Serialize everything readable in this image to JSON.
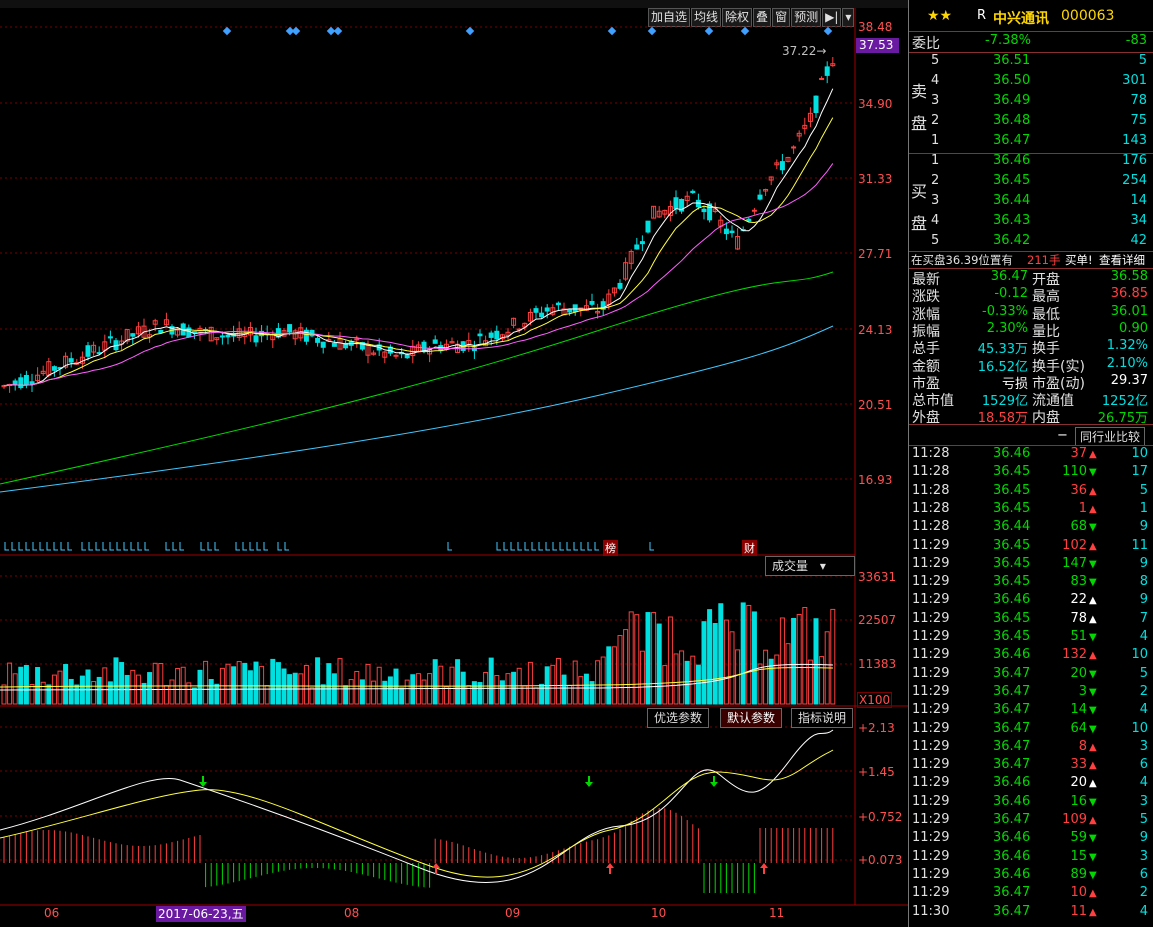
{
  "toolbar": {
    "buttons": [
      "加自选",
      "均线",
      "除权",
      "叠",
      "窗",
      "预测"
    ],
    "arrow": "▶|"
  },
  "stock": {
    "stars": "★★",
    "prefix": "R",
    "name": "中兴通讯",
    "code": "000063"
  },
  "weibi": {
    "label": "委比",
    "pct": "-7.38%",
    "diff": "-83"
  },
  "sell": {
    "side_label": [
      "卖",
      "盘"
    ],
    "rows": [
      {
        "level": "5",
        "price": "36.51",
        "vol": "5"
      },
      {
        "level": "4",
        "price": "36.50",
        "vol": "301"
      },
      {
        "level": "3",
        "price": "36.49",
        "vol": "78"
      },
      {
        "level": "2",
        "price": "36.48",
        "vol": "75"
      },
      {
        "level": "1",
        "price": "36.47",
        "vol": "143"
      }
    ]
  },
  "buy": {
    "side_label": [
      "买",
      "盘"
    ],
    "rows": [
      {
        "level": "1",
        "price": "36.46",
        "vol": "176"
      },
      {
        "level": "2",
        "price": "36.45",
        "vol": "254"
      },
      {
        "level": "3",
        "price": "36.44",
        "vol": "14"
      },
      {
        "level": "4",
        "price": "36.43",
        "vol": "34"
      },
      {
        "level": "5",
        "price": "36.42",
        "vol": "42"
      }
    ]
  },
  "notice": {
    "text": "在买盘36.39位置有",
    "amount": "211手",
    "tag": "买单!",
    "link": "查看详细"
  },
  "stats": [
    {
      "l1": "最新",
      "v1": "36.47",
      "c1": "green",
      "l2": "开盘",
      "v2": "36.58",
      "c2": "green"
    },
    {
      "l1": "涨跌",
      "v1": "-0.12",
      "c1": "green",
      "l2": "最高",
      "v2": "36.85",
      "c2": "red"
    },
    {
      "l1": "涨幅",
      "v1": "-0.33%",
      "c1": "green",
      "l2": "最低",
      "v2": "36.01",
      "c2": "green"
    },
    {
      "l1": "振幅",
      "v1": "2.30%",
      "c1": "green",
      "l2": "量比",
      "v2": "0.90",
      "c2": "green"
    },
    {
      "l1": "总手",
      "v1": "45.33万",
      "c1": "cyan",
      "l2": "换手",
      "v2": "1.32%",
      "c2": "cyan"
    },
    {
      "l1": "金额",
      "v1": "16.52亿",
      "c1": "cyan",
      "l2": "换手(实)",
      "v2": "2.10%",
      "c2": "cyan"
    },
    {
      "l1": "市盈",
      "v1": "亏损",
      "c1": "white",
      "l2": "市盈(动)",
      "v2": "29.37",
      "c2": "white"
    },
    {
      "l1": "总市值",
      "v1": "1529亿",
      "c1": "cyan",
      "l2": "流通值",
      "v2": "1252亿",
      "c2": "cyan"
    },
    {
      "l1": "外盘",
      "v1": "18.58万",
      "c1": "red",
      "l2": "内盘",
      "v2": "26.75万",
      "c2": "green"
    }
  ],
  "industry": {
    "minus": "−",
    "button": "同行业比较"
  },
  "ticks": [
    {
      "t": "11:28",
      "p": "36.46",
      "v": "37",
      "d": "up",
      "n": "10",
      "c": "red"
    },
    {
      "t": "11:28",
      "p": "36.45",
      "v": "110",
      "d": "down",
      "n": "17",
      "c": "green"
    },
    {
      "t": "11:28",
      "p": "36.45",
      "v": "36",
      "d": "up",
      "n": "5",
      "c": "red"
    },
    {
      "t": "11:28",
      "p": "36.45",
      "v": "1",
      "d": "up",
      "n": "1",
      "c": "red"
    },
    {
      "t": "11:28",
      "p": "36.44",
      "v": "68",
      "d": "down",
      "n": "9",
      "c": "green"
    },
    {
      "t": "11:29",
      "p": "36.45",
      "v": "102",
      "d": "up",
      "n": "11",
      "c": "red"
    },
    {
      "t": "11:29",
      "p": "36.45",
      "v": "147",
      "d": "down",
      "n": "9",
      "c": "green"
    },
    {
      "t": "11:29",
      "p": "36.45",
      "v": "83",
      "d": "down",
      "n": "8",
      "c": "green"
    },
    {
      "t": "11:29",
      "p": "36.46",
      "v": "22",
      "d": "up",
      "n": "9",
      "c": "white"
    },
    {
      "t": "11:29",
      "p": "36.45",
      "v": "78",
      "d": "up",
      "n": "7",
      "c": "white"
    },
    {
      "t": "11:29",
      "p": "36.45",
      "v": "51",
      "d": "down",
      "n": "4",
      "c": "green"
    },
    {
      "t": "11:29",
      "p": "36.46",
      "v": "132",
      "d": "up",
      "n": "10",
      "c": "red"
    },
    {
      "t": "11:29",
      "p": "36.47",
      "v": "20",
      "d": "down",
      "n": "5",
      "c": "green"
    },
    {
      "t": "11:29",
      "p": "36.47",
      "v": "3",
      "d": "down",
      "n": "2",
      "c": "green"
    },
    {
      "t": "11:29",
      "p": "36.47",
      "v": "14",
      "d": "down",
      "n": "4",
      "c": "green"
    },
    {
      "t": "11:29",
      "p": "36.47",
      "v": "64",
      "d": "down",
      "n": "10",
      "c": "green"
    },
    {
      "t": "11:29",
      "p": "36.47",
      "v": "8",
      "d": "up",
      "n": "3",
      "c": "red"
    },
    {
      "t": "11:29",
      "p": "36.47",
      "v": "33",
      "d": "up",
      "n": "6",
      "c": "red"
    },
    {
      "t": "11:29",
      "p": "36.46",
      "v": "20",
      "d": "up",
      "n": "4",
      "c": "white"
    },
    {
      "t": "11:29",
      "p": "36.46",
      "v": "16",
      "d": "down",
      "n": "3",
      "c": "green"
    },
    {
      "t": "11:29",
      "p": "36.47",
      "v": "109",
      "d": "up",
      "n": "5",
      "c": "red"
    },
    {
      "t": "11:29",
      "p": "36.46",
      "v": "59",
      "d": "down",
      "n": "9",
      "c": "green"
    },
    {
      "t": "11:29",
      "p": "36.46",
      "v": "15",
      "d": "down",
      "n": "3",
      "c": "green"
    },
    {
      "t": "11:29",
      "p": "36.46",
      "v": "89",
      "d": "down",
      "n": "6",
      "c": "green"
    },
    {
      "t": "11:29",
      "p": "36.47",
      "v": "10",
      "d": "up",
      "n": "2",
      "c": "red"
    },
    {
      "t": "11:30",
      "p": "36.47",
      "v": "11",
      "d": "up",
      "n": "4",
      "c": "red"
    }
  ],
  "price_axis": {
    "labels": [
      "38.48",
      "34.90",
      "31.33",
      "27.71",
      "24.13",
      "20.51",
      "16.93"
    ],
    "current": "37.53",
    "high_marker": "37.22"
  },
  "volume": {
    "selector": "成交量",
    "labels": [
      "33631",
      "22507",
      "11383"
    ],
    "unit": "X100"
  },
  "macd": {
    "tabs": [
      "优选参数",
      "默认参数",
      "指标说明"
    ],
    "labels": [
      "+2.13",
      "+1.45",
      "+0.752",
      "+0.073"
    ]
  },
  "date_axis": {
    "labels": [
      {
        "text": "06",
        "x": 52
      },
      {
        "text": "08",
        "x": 352
      },
      {
        "text": "09",
        "x": 513
      },
      {
        "text": "10",
        "x": 659
      },
      {
        "text": "11",
        "x": 777
      }
    ],
    "highlight": "2017-06-23,五"
  },
  "signal_tags": {
    "bang": "榜",
    "cai": "财"
  },
  "colors": {
    "up": "#ff4040",
    "down": "#00e0e0",
    "ma5": "#ffffff",
    "ma10": "#ffff40",
    "ma20": "#ff60ff",
    "ma60": "#00d800",
    "ma120": "#40c8ff",
    "grid": "#7a0000"
  },
  "chart_data": {
    "type": "candlestick",
    "title": "",
    "x_range": [
      "2017-05",
      "2017-11"
    ],
    "ylim": [
      16.93,
      38.48
    ],
    "high_marker": 37.22,
    "current_price": 37.53
  }
}
